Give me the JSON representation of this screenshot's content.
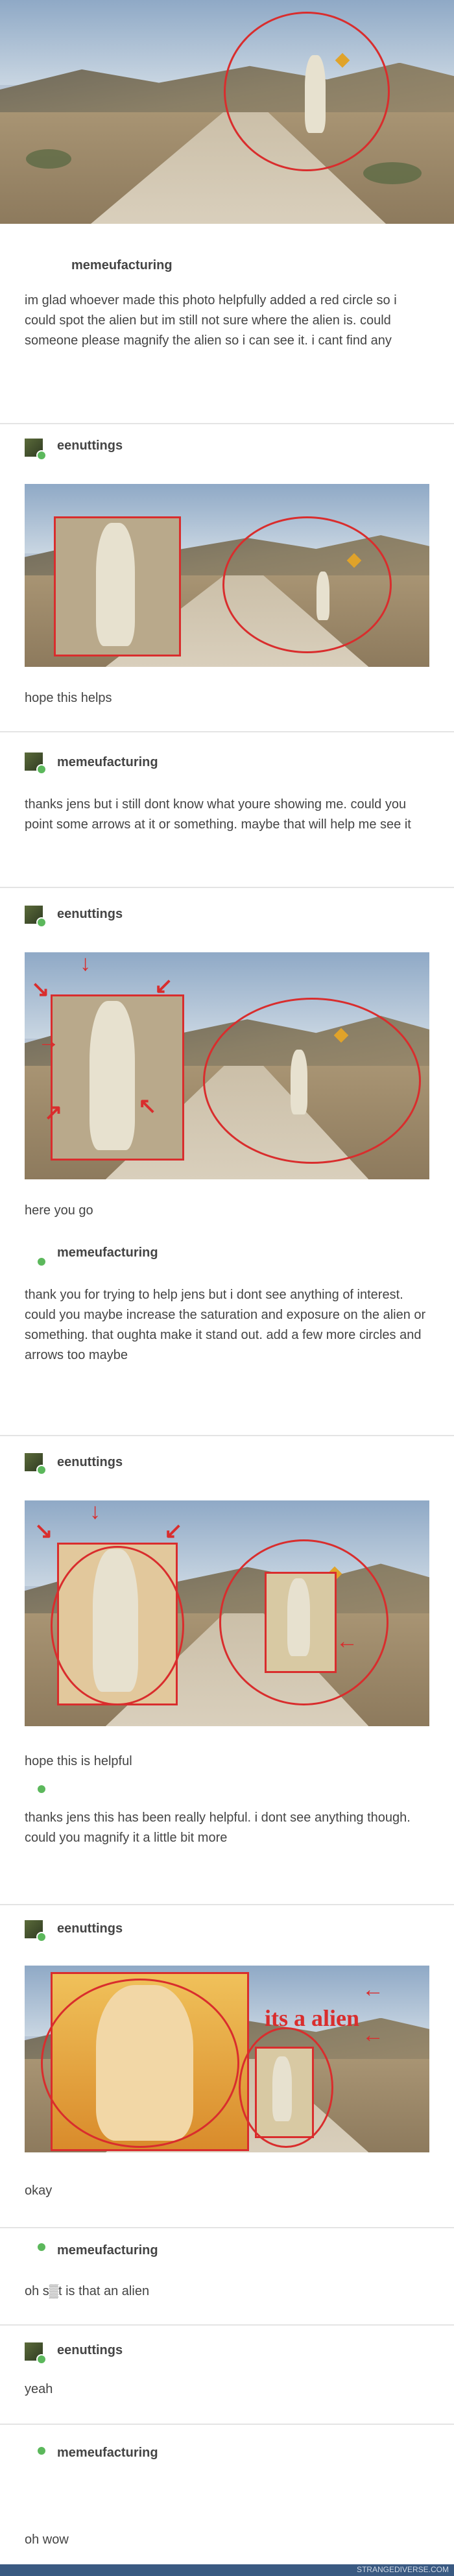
{
  "posts": [
    {
      "user": "memeufacturing",
      "text": "im glad whoever made this photo helpfully added a red circle so i could spot the alien but im still not sure where the alien is. could someone please magnify the alien so i can see it. i cant find any"
    },
    {
      "user": "eenuttings",
      "text": "hope this helps"
    },
    {
      "user": "memeufacturing",
      "text": "thanks jens but i still dont know what youre showing me. could you point some arrows at it or something. maybe that will help me see it"
    },
    {
      "user": "eenuttings",
      "text": "here you go"
    },
    {
      "user": "memeufacturing",
      "text": "thank you for trying to help jens but i dont see anything of interest. could you maybe increase the saturation and exposure on the alien or something. that oughta make it stand out. add a few more circles and arrows too maybe"
    },
    {
      "user": "eenuttings",
      "text": "hope this is helpful"
    },
    {
      "user": "",
      "text": "thanks jens this has been really helpful. i dont see anything though. could you magnify it a little bit more"
    },
    {
      "user": "eenuttings",
      "text": "okay"
    },
    {
      "user": "memeufacturing",
      "text": "oh s▒t is that an alien"
    },
    {
      "user": "eenuttings",
      "text": "yeah"
    },
    {
      "user": "memeufacturing",
      "text": "oh wow"
    }
  ],
  "image_caption": "its a alien",
  "footer": "STRANGEDIVERSE.COM"
}
